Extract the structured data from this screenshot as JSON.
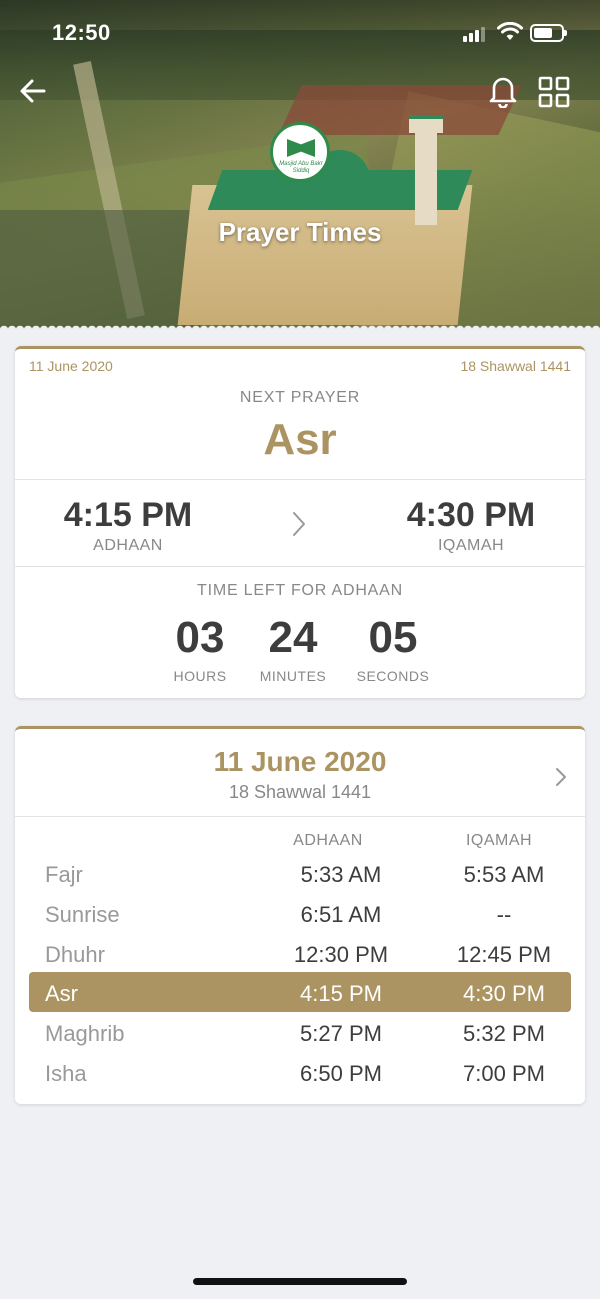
{
  "status_bar": {
    "time": "12:50"
  },
  "header": {
    "title": "Prayer Times",
    "logo_text": "Masjid Abu Bakr Siddiq"
  },
  "next_prayer_card": {
    "date_gregorian": "11 June 2020",
    "date_hijri": "18 Shawwal 1441",
    "next_prayer_label": "NEXT PRAYER",
    "next_prayer_name": "Asr",
    "adhaan_time": "4:15 PM",
    "adhaan_label": "ADHAAN",
    "iqamah_time": "4:30 PM",
    "iqamah_label": "IQAMAH",
    "countdown_label": "TIME LEFT FOR ADHAAN",
    "countdown": [
      {
        "value": "03",
        "unit": "HOURS"
      },
      {
        "value": "24",
        "unit": "MINUTES"
      },
      {
        "value": "05",
        "unit": "SECONDS"
      }
    ]
  },
  "timetable_card": {
    "date_gregorian": "11 June 2020",
    "date_hijri": "18 Shawwal 1441",
    "columns": [
      "ADHAAN",
      "IQAMAH"
    ],
    "rows": [
      {
        "name": "Fajr",
        "adhaan": "5:33 AM",
        "iqamah": "5:53 AM"
      },
      {
        "name": "Sunrise",
        "adhaan": "6:51 AM",
        "iqamah": "--"
      },
      {
        "name": "Dhuhr",
        "adhaan": "12:30 PM",
        "iqamah": "12:45 PM"
      },
      {
        "name": "Asr",
        "adhaan": "4:15 PM",
        "iqamah": "4:30 PM"
      },
      {
        "name": "Maghrib",
        "adhaan": "5:27 PM",
        "iqamah": "5:32 PM"
      },
      {
        "name": "Isha",
        "adhaan": "6:50 PM",
        "iqamah": "7:00 PM"
      }
    ],
    "active_index": 3
  },
  "colors": {
    "accent": "#ab9462",
    "background": "#eef0f4",
    "text": "#3d3d3d",
    "muted": "#888888"
  },
  "icons": [
    "back-arrow-icon",
    "bell-icon",
    "grid-icon",
    "chevron-right-icon"
  ]
}
